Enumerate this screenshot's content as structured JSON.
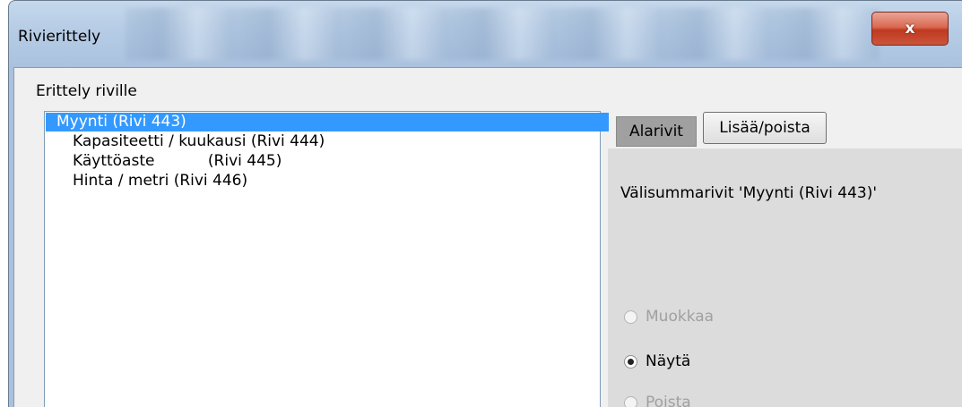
{
  "window": {
    "title": "Rivierittely",
    "close_label": "x"
  },
  "group": {
    "label": "Erittely riville"
  },
  "list": {
    "items": [
      {
        "label": "Myynti (Rivi 443)",
        "selected": true,
        "level": 0
      },
      {
        "label": "Kapasiteetti / kuukausi (Rivi 444)",
        "selected": false,
        "level": 1
      },
      {
        "label": "Käyttöaste           (Rivi 445)",
        "selected": false,
        "level": 1
      },
      {
        "label": "Hinta / metri (Rivi 446)",
        "selected": false,
        "level": 1
      }
    ]
  },
  "tabs": {
    "active_label": "Alarivit",
    "other_label": "Lisää/poista"
  },
  "panel": {
    "subtotal_text": "Välisummarivit 'Myynti (Rivi 443)'",
    "options": [
      {
        "label": "Muokkaa",
        "checked": false,
        "enabled": false
      },
      {
        "label": "Näytä",
        "checked": true,
        "enabled": true
      },
      {
        "label": "Poista",
        "checked": false,
        "enabled": false
      }
    ]
  },
  "colors": {
    "selection": "#3399ff",
    "close_button": "#c9553c"
  }
}
